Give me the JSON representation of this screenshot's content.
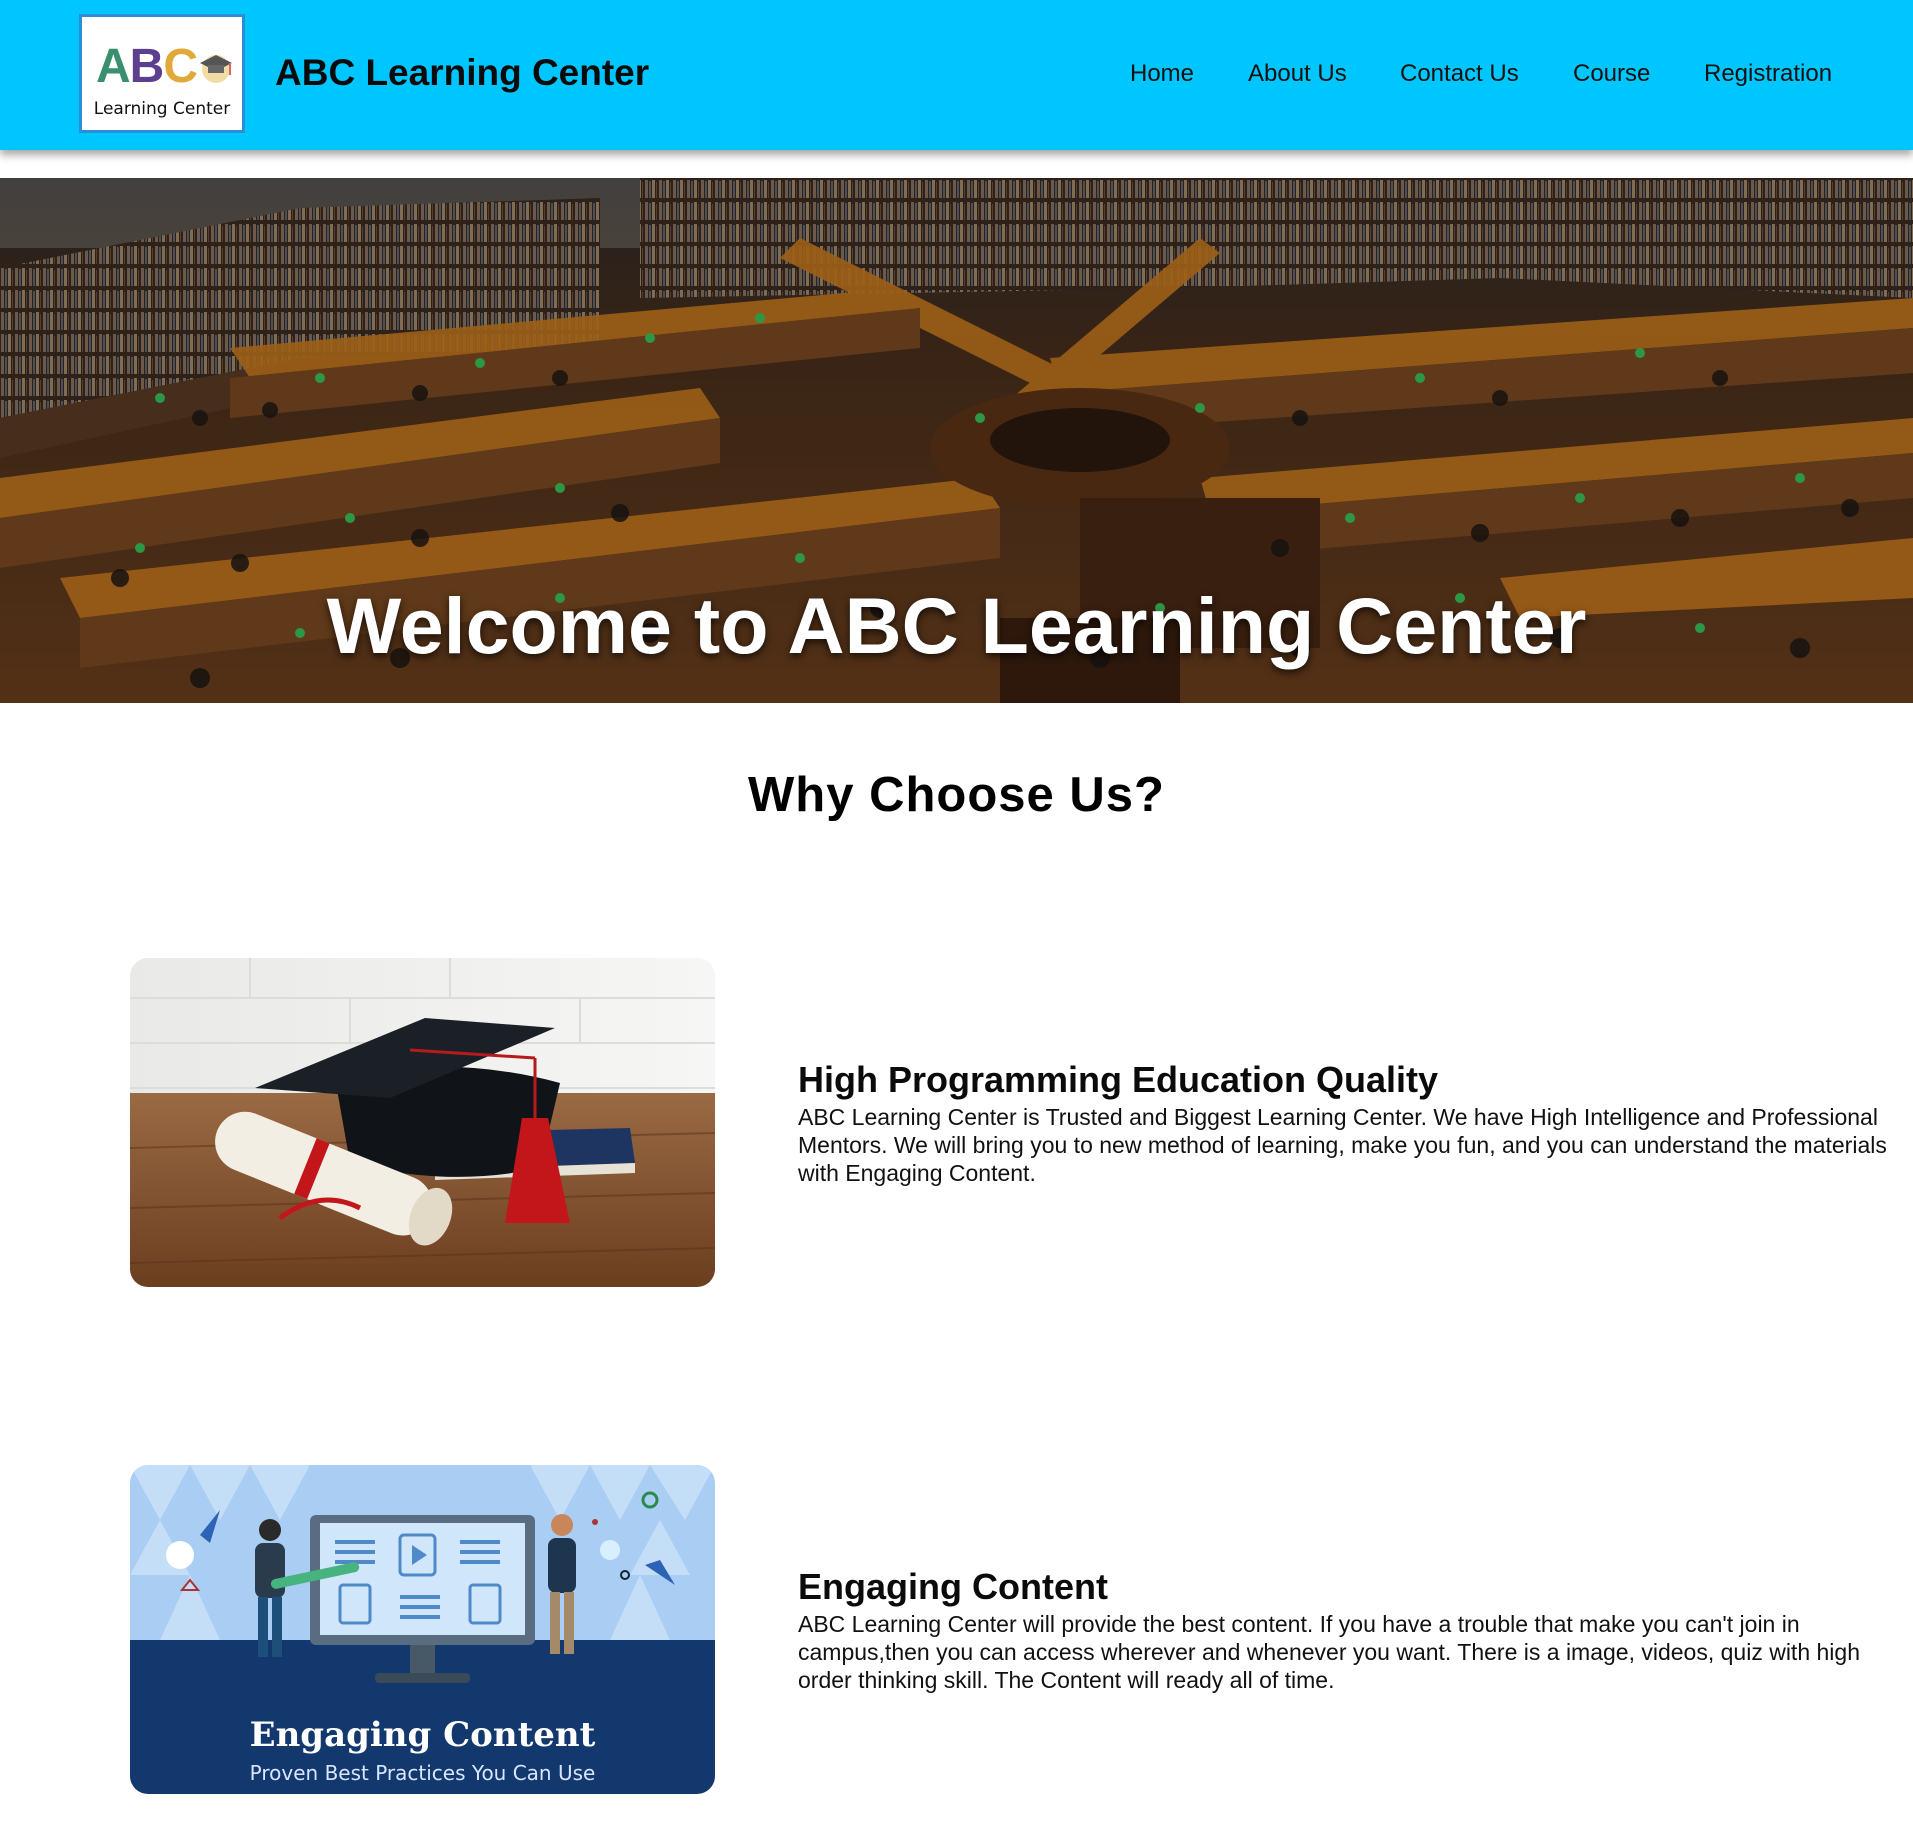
{
  "header": {
    "logo": {
      "letters": [
        "A",
        "B",
        "C"
      ],
      "caption": "Learning Center"
    },
    "brand": "ABC Learning Center",
    "nav": [
      "Home",
      "About Us",
      "Contact Us",
      "Course",
      "Registration"
    ]
  },
  "hero": {
    "title": "Welcome to ABC Learning Center",
    "image": "library-reading-room-photo"
  },
  "why": {
    "title": "Why Choose Us?",
    "features": [
      {
        "image": "graduation-cap-and-diploma-photo",
        "title": "High Programming Education Quality",
        "body": "ABC Learning Center is Trusted and Biggest Learning Center. We have High Intelligence and Professional Mentors. We will bring you to new method of learning, make you fun, and you can understand the materials with Engaging Content."
      },
      {
        "image": "engaging-content-illustration",
        "image_title": "Engaging Content",
        "image_subtitle": "Proven Best Practices You Can Use",
        "title": "Engaging Content",
        "body": "ABC Learning Center will provide the best content. If you have a trouble that make you can't join in campus,then you can access wherever and whenever you want. There is a image, videos, quiz with high order thinking skill. The Content will ready all of time."
      }
    ]
  },
  "colors": {
    "header_bg": "#00c6ff",
    "illustration_navy": "#12386e"
  }
}
